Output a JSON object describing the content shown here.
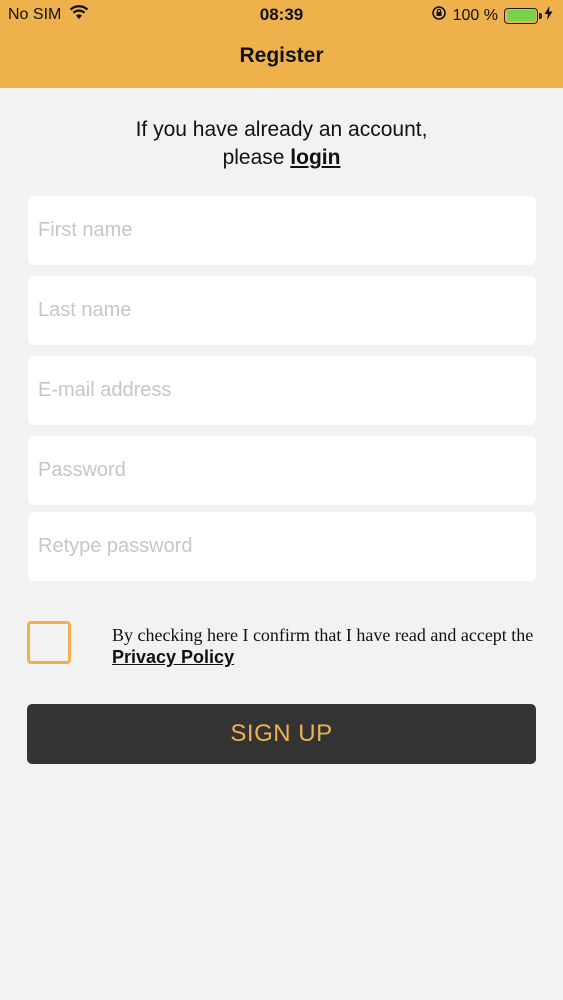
{
  "status_bar": {
    "carrier": "No SIM",
    "time": "08:39",
    "battery_percent": "100 %",
    "battery_level": 1.0
  },
  "header": {
    "title": "Register"
  },
  "intro": {
    "line1": "If you have already an account,",
    "line2_prefix": "please ",
    "login_link": "login"
  },
  "form": {
    "first_name_placeholder": "First name",
    "last_name_placeholder": "Last name",
    "email_placeholder": "E-mail address",
    "password_placeholder": "Password",
    "retype_password_placeholder": "Retype password"
  },
  "consent": {
    "text": "By checking here I confirm that I have read and accept the ",
    "privacy_link": "Privacy Policy",
    "checked": false
  },
  "signup_label": "SIGN UP",
  "colors": {
    "accent": "#eeb14c",
    "button_bg": "#333333",
    "background": "#f2f2f2"
  }
}
